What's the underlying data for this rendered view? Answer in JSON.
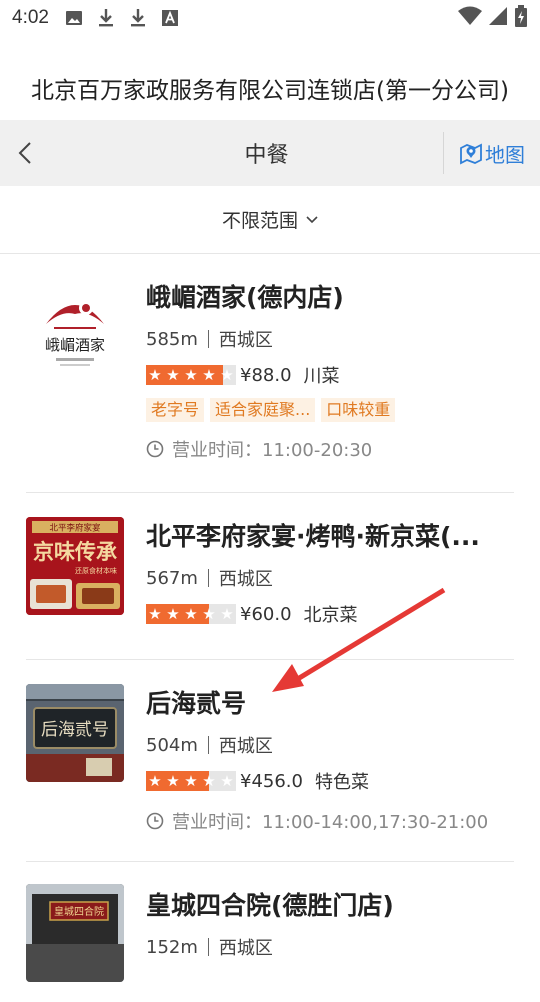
{
  "status_bar": {
    "time": "4:02",
    "icons": [
      "image-icon",
      "download-icon",
      "download-icon",
      "a-icon"
    ],
    "right_icons": [
      "wifi-icon",
      "signal-icon",
      "battery-icon"
    ]
  },
  "shop_title": "北京百万家政服务有限公司连锁店(第一分公司)",
  "nav": {
    "title": "中餐",
    "map_label": "地图"
  },
  "filter": {
    "label": "不限范围"
  },
  "colors": {
    "accent_blue": "#2f7fd8",
    "star_orange": "#f06a30",
    "tag_bg": "#fdf1e3",
    "tag_text": "#e07a22"
  },
  "restaurants": [
    {
      "name": "峨嵋酒家(德内店)",
      "distance": "585m",
      "district": "西城区",
      "rating_fraction": 0.85,
      "price": "¥88.0",
      "cuisine": "川菜",
      "tags": [
        "老字号",
        "适合家庭聚...",
        "口味较重"
      ],
      "hours": "营业时间：11:00-20:30",
      "logo_text": "峨嵋酒家"
    },
    {
      "name": "北平李府家宴·烤鸭·新京菜(...",
      "distance": "567m",
      "district": "西城区",
      "rating_fraction": 0.7,
      "price": "¥60.0",
      "cuisine": "北京菜",
      "thumb_title": "北平李府家宴",
      "thumb_big": "京味传承",
      "thumb_sub": "还原食材本味"
    },
    {
      "name": "后海贰号",
      "distance": "504m",
      "district": "西城区",
      "rating_fraction": 0.7,
      "price": "¥456.0",
      "cuisine": "特色菜",
      "hours": "营业时间：11:00-14:00,17:30-21:00",
      "sign_text": "后海贰号"
    },
    {
      "name": "皇城四合院(德胜门店)",
      "distance": "152m",
      "district": "西城区",
      "sign_text": "皇城四合院"
    }
  ]
}
